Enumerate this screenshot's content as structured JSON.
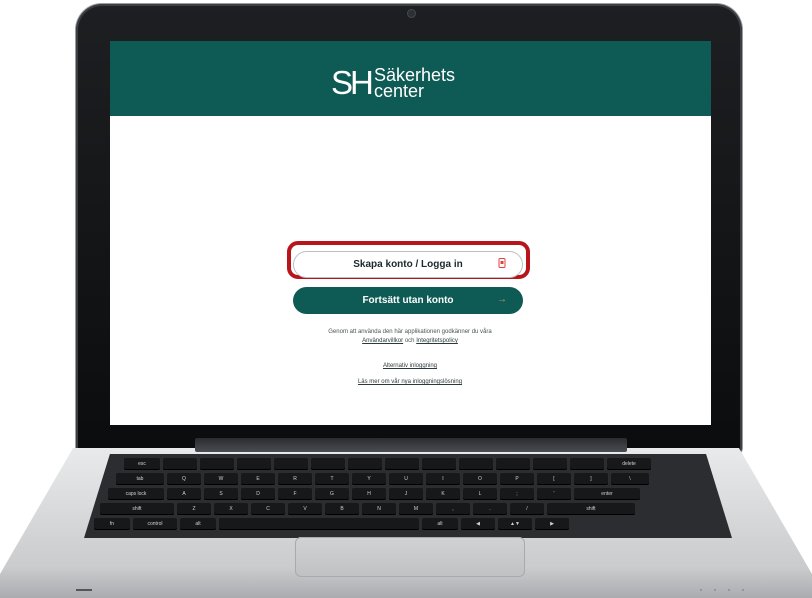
{
  "brand": {
    "mark": "SH",
    "line1": "Säkerhets",
    "line2": "center"
  },
  "actions": {
    "primary_label": "Skapa konto / Logga in",
    "secondary_label": "Fortsätt utan konto"
  },
  "consent": {
    "text": "Genom att använda den här applikationen godkänner du våra",
    "terms_link": "Användarvillkor",
    "conjunction": "och",
    "privacy_link": "Integritetspolicy"
  },
  "links": {
    "alt_login": "Alternativ inloggning",
    "read_more": "Läs mer om vår nya inloggningslösning"
  },
  "keyboard": {
    "row1": [
      "esc",
      "",
      "",
      "",
      "",
      "",
      "",
      "",
      "",
      "",
      "",
      "",
      "",
      "delete"
    ],
    "row2": [
      "tab",
      "Q",
      "W",
      "E",
      "R",
      "T",
      "Y",
      "U",
      "I",
      "O",
      "P",
      "[",
      "]",
      "\\"
    ],
    "row3": [
      "caps lock",
      "A",
      "S",
      "D",
      "F",
      "G",
      "H",
      "J",
      "K",
      "L",
      ";",
      "'",
      "enter"
    ],
    "row4": [
      "shift",
      "Z",
      "X",
      "C",
      "V",
      "B",
      "N",
      "M",
      ",",
      ".",
      "/",
      "shift"
    ],
    "row5": [
      "fn",
      "control",
      "alt",
      "",
      "alt",
      "◀",
      "▲▼",
      "▶"
    ]
  },
  "colors": {
    "brand_teal": "#0e5a55",
    "highlight_red": "#b8141c",
    "accent_orange": "#f08a5a"
  },
  "icons": {
    "primary_button": "id-card-icon",
    "secondary_button": "arrow-right-icon"
  }
}
